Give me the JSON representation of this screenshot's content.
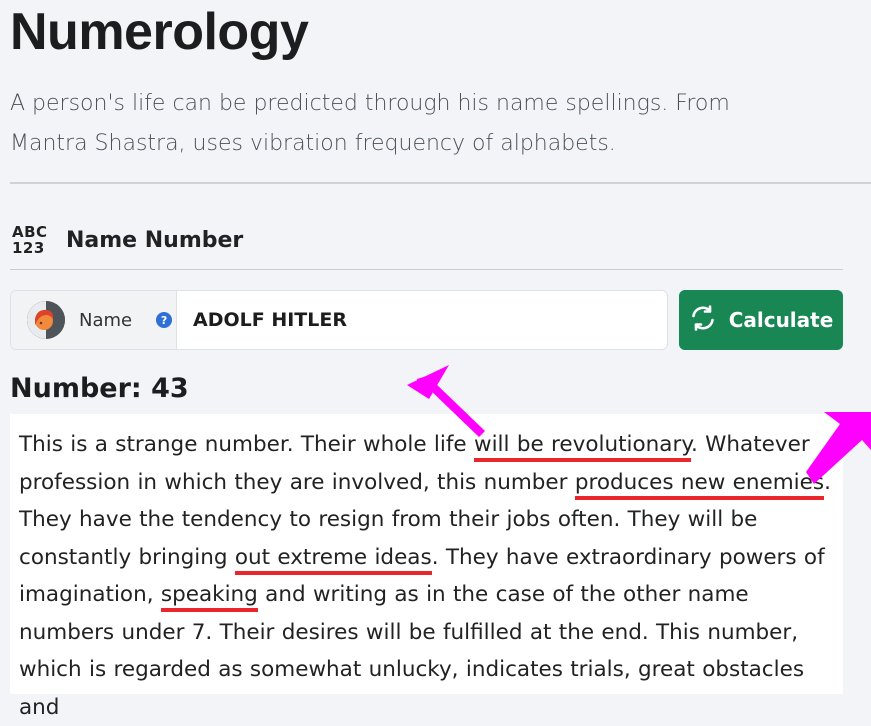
{
  "page": {
    "title": "Numerology",
    "subtitle": "A person's life can be predicted through his name spellings. From Mantra Shastra, uses vibration frequency of alphabets."
  },
  "section": {
    "icon_line1": "ABC",
    "icon_line2": "123",
    "label": "Name Number"
  },
  "form": {
    "name_label": "Name",
    "help_icon": "?",
    "name_value": "ADOLF HITLER",
    "calculate_label": "Calculate"
  },
  "result": {
    "heading": "Number: 43",
    "p1": "This is a strange number. Their whole life ",
    "h1": "will be revolutionary",
    "p2": ". Whatever profession in which they are involved, this number ",
    "h2": "produces new enemies",
    "p3": ". They have the tendency to resign from their jobs often. They will be constantly bringing ",
    "h3": "out extreme ideas",
    "p4": ". They have extraordinary powers of imagination, ",
    "h4": "speaking",
    "p5": " and writing as in the case of the other name numbers under 7. Their desires will be fulfilled at the end. This number, which is regarded as somewhat unlucky, indicates trials, great obstacles and"
  },
  "colors": {
    "button": "#198754",
    "highlight_underline": "#e8262b",
    "annotation_arrow": "#ff00ff"
  },
  "icons": [
    "abc-123-icon",
    "avatar-icon",
    "help-icon",
    "refresh-icon",
    "arrow-annotation-icon"
  ]
}
